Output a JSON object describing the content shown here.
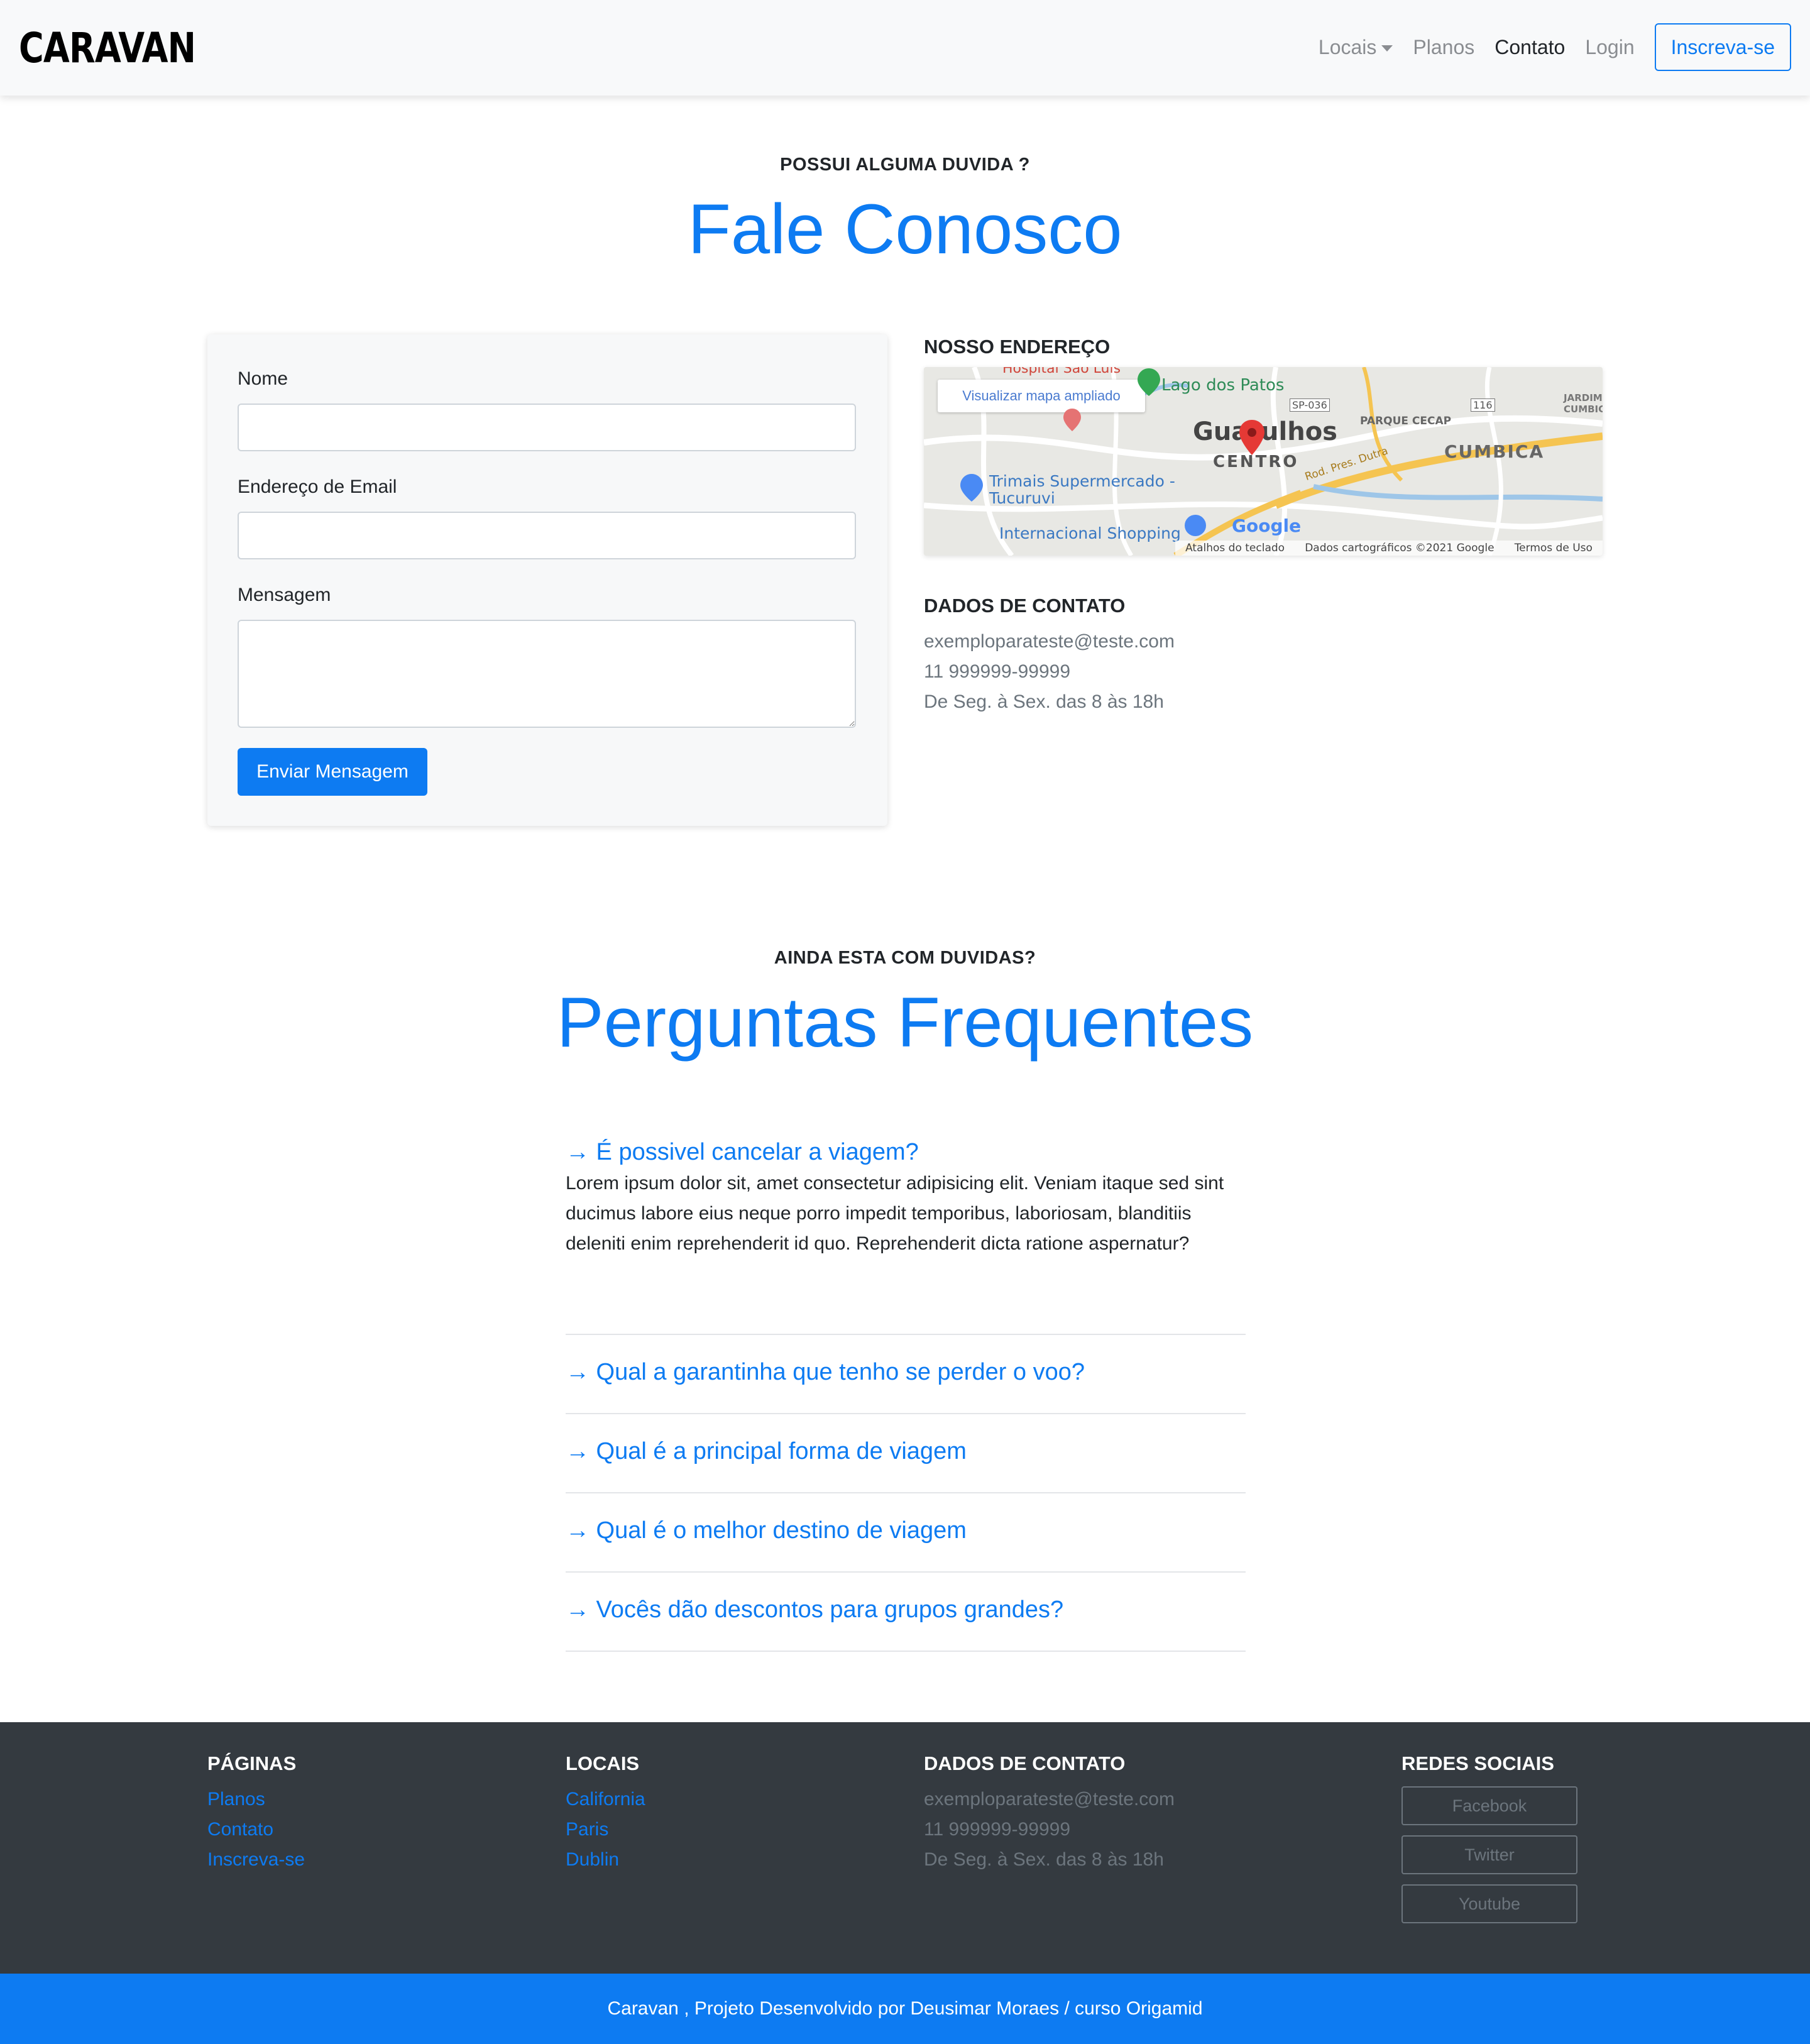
{
  "nav": {
    "brand": "CARAVAN",
    "links": [
      "Locais",
      "Planos",
      "Contato",
      "Login"
    ],
    "cta": "Inscreva-se"
  },
  "contact": {
    "eyebrow": "POSSUI ALGUMA DUVIDA ?",
    "title": "Fale Conosco",
    "form": {
      "name_label": "Nome",
      "name_value": "",
      "email_label": "Endereço de Email",
      "email_value": "",
      "message_label": "Mensagem",
      "message_value": "",
      "submit": "Enviar Mensagem"
    },
    "address_heading": "NOSSO ENDEREÇO",
    "map": {
      "enlarge": "Visualizar mapa ampliado",
      "labels": [
        "Hospital São Luis",
        "Lago dos Patos",
        "SP-036",
        "Guarulhos",
        "CENTRO",
        "PARQUE CECAP",
        "116",
        "CUMBICA",
        "JARDIM CUMBICA",
        "Trimais Supermercado - Tucuruvi",
        "Internacional Shopping",
        "Rod. Pres. Dutra",
        "Google"
      ],
      "footer": [
        "Atalhos do teclado",
        "Dados cartográficos ©2021 Google",
        "Termos de Uso"
      ]
    },
    "details_heading": "DADOS DE CONTATO",
    "email": "exemploparateste@teste.com",
    "phone": "11 999999-99999",
    "hours": "De Seg. à Sex. das 8 às 18h"
  },
  "faq": {
    "eyebrow": "AINDA ESTA COM DUVIDAS?",
    "title": "Perguntas Frequentes",
    "items": [
      {
        "q": "→ É possivel cancelar a viagem?",
        "a": "Lorem ipsum dolor sit, amet consectetur adipisicing elit. Veniam itaque sed sint ducimus labore eius neque porro impedit temporibus, laboriosam, blanditiis deleniti enim reprehenderit id quo. Reprehenderit dicta ratione aspernatur?"
      },
      {
        "q": "→ Qual a garantinha que tenho se perder o voo?"
      },
      {
        "q": "→ Qual é a principal forma de viagem"
      },
      {
        "q": "→ Qual é o melhor destino de viagem"
      },
      {
        "q": "→ Vocês dão descontos para grupos grandes?"
      }
    ]
  },
  "footer": {
    "pages_heading": "PÁGINAS",
    "pages": [
      "Planos",
      "Contato",
      "Inscreva-se"
    ],
    "locations_heading": "LOCAIS",
    "locations": [
      "California",
      "Paris",
      "Dublin"
    ],
    "contact_heading": "DADOS DE CONTATO",
    "email": "exemploparateste@teste.com",
    "phone": "11 999999-99999",
    "hours": "De Seg. à Sex. das 8 às 18h",
    "social_heading": "REDES SOCIAIS",
    "social": [
      "Facebook",
      "Twitter",
      "Youtube"
    ],
    "credit": "Caravan , Projeto Desenvolvido por Deusimar Moraes / curso Origamid"
  },
  "colors": {
    "primary": "#0d7bf2",
    "navbar_bg": "#f8f9fa",
    "footer_bg": "#343a40",
    "muted": "#6c757d"
  }
}
